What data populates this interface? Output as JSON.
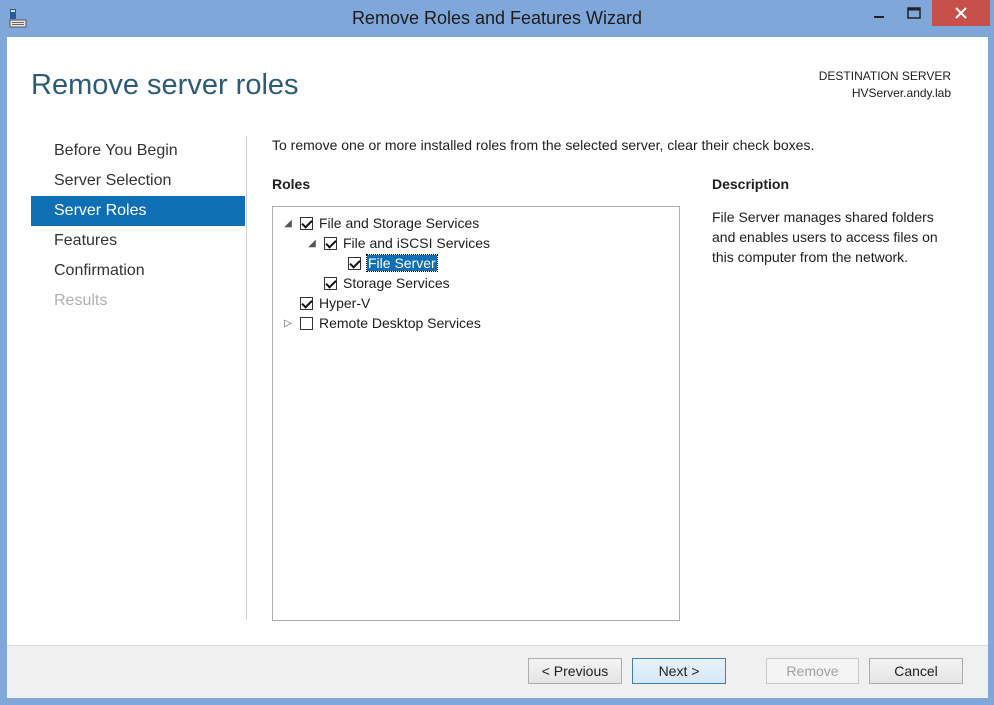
{
  "window": {
    "title": "Remove Roles and Features Wizard",
    "icon": "server-manager-icon",
    "controls": {
      "minimize": "minimize-icon",
      "maximize": "maximize-icon",
      "close": "close-icon"
    },
    "colors": {
      "titlebar": "#7fa7d9",
      "close": "#c7504b",
      "accent": "#0f6fb5",
      "title_text": "#2b5c7a"
    }
  },
  "header": {
    "page_title": "Remove server roles",
    "destination_label": "DESTINATION SERVER",
    "destination_server": "HVServer.andy.lab"
  },
  "nav": {
    "items": [
      {
        "label": "Before You Begin",
        "state": "normal"
      },
      {
        "label": "Server Selection",
        "state": "normal"
      },
      {
        "label": "Server Roles",
        "state": "active"
      },
      {
        "label": "Features",
        "state": "normal"
      },
      {
        "label": "Confirmation",
        "state": "normal"
      },
      {
        "label": "Results",
        "state": "disabled"
      }
    ]
  },
  "content": {
    "instruction": "To remove one or more installed roles from the selected server, clear their check boxes.",
    "roles_label": "Roles",
    "description_label": "Description",
    "description_text": "File Server manages shared folders and enables users to access files on this computer from the network.",
    "roles": [
      {
        "label": "File and Storage Services",
        "checked": true,
        "expander": "expanded",
        "level": 0
      },
      {
        "label": "File and iSCSI Services",
        "checked": true,
        "expander": "expanded",
        "level": 1
      },
      {
        "label": "File Server",
        "checked": true,
        "expander": "none",
        "level": 2,
        "selected": true
      },
      {
        "label": "Storage Services",
        "checked": true,
        "expander": "none",
        "level": 1
      },
      {
        "label": "Hyper-V",
        "checked": true,
        "expander": "none",
        "level": 0
      },
      {
        "label": "Remote Desktop Services",
        "checked": false,
        "expander": "collapsed",
        "level": 0
      }
    ]
  },
  "buttons": {
    "previous": "< Previous",
    "next": "Next >",
    "remove": "Remove",
    "cancel": "Cancel"
  }
}
